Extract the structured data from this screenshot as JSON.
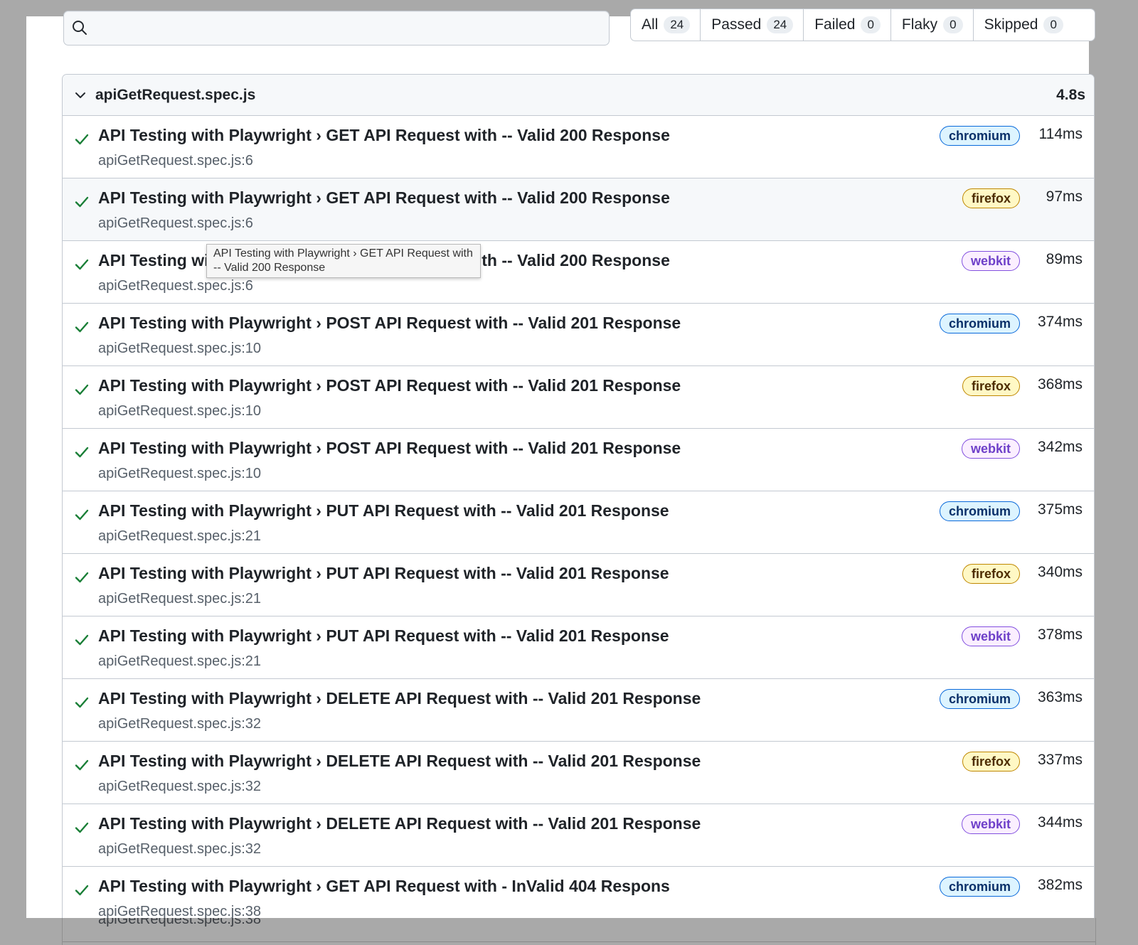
{
  "search": {
    "placeholder": "",
    "value": ""
  },
  "filters": [
    {
      "label": "All",
      "count": "24"
    },
    {
      "label": "Passed",
      "count": "24"
    },
    {
      "label": "Failed",
      "count": "0"
    },
    {
      "label": "Flaky",
      "count": "0"
    },
    {
      "label": "Skipped",
      "count": "0"
    }
  ],
  "suite": {
    "file": "apiGetRequest.spec.js",
    "duration": "4.8s",
    "tests": [
      {
        "title": "API Testing with Playwright › GET API Request with -- Valid 200 Response",
        "location": "apiGetRequest.spec.js:6",
        "browser": "chromium",
        "duration": "114ms"
      },
      {
        "title": "API Testing with Playwright › GET API Request with -- Valid 200 Response",
        "location": "apiGetRequest.spec.js:6",
        "browser": "firefox",
        "duration": "97ms"
      },
      {
        "title": "API Testing with Playwright › GET API Request with -- Valid 200 Response",
        "location": "apiGetRequest.spec.js:6",
        "browser": "webkit",
        "duration": "89ms"
      },
      {
        "title": "API Testing with Playwright › POST API Request with -- Valid 201 Response",
        "location": "apiGetRequest.spec.js:10",
        "browser": "chromium",
        "duration": "374ms"
      },
      {
        "title": "API Testing with Playwright › POST API Request with -- Valid 201 Response",
        "location": "apiGetRequest.spec.js:10",
        "browser": "firefox",
        "duration": "368ms"
      },
      {
        "title": "API Testing with Playwright › POST API Request with -- Valid 201 Response",
        "location": "apiGetRequest.spec.js:10",
        "browser": "webkit",
        "duration": "342ms"
      },
      {
        "title": "API Testing with Playwright › PUT API Request with -- Valid 201 Response",
        "location": "apiGetRequest.spec.js:21",
        "browser": "chromium",
        "duration": "375ms"
      },
      {
        "title": "API Testing with Playwright › PUT API Request with -- Valid 201 Response",
        "location": "apiGetRequest.spec.js:21",
        "browser": "firefox",
        "duration": "340ms"
      },
      {
        "title": "API Testing with Playwright › PUT API Request with -- Valid 201 Response",
        "location": "apiGetRequest.spec.js:21",
        "browser": "webkit",
        "duration": "378ms"
      },
      {
        "title": "API Testing with Playwright › DELETE API Request with -- Valid 201 Response",
        "location": "apiGetRequest.spec.js:32",
        "browser": "chromium",
        "duration": "363ms"
      },
      {
        "title": "API Testing with Playwright › DELETE API Request with -- Valid 201 Response",
        "location": "apiGetRequest.spec.js:32",
        "browser": "firefox",
        "duration": "337ms"
      },
      {
        "title": "API Testing with Playwright › DELETE API Request with -- Valid 201 Response",
        "location": "apiGetRequest.spec.js:32",
        "browser": "webkit",
        "duration": "344ms"
      },
      {
        "title": "API Testing with Playwright › GET API Request with - InValid 404 Respons",
        "location": "apiGetRequest.spec.js:38",
        "browser": "chromium",
        "duration": "382ms"
      }
    ]
  },
  "tooltip": {
    "text": "API Testing with Playwright › GET API Request with -- Valid 200 Response"
  },
  "icons": {
    "search": "search-icon",
    "chevron": "chevron-down-icon",
    "check": "check-icon"
  },
  "colors": {
    "check": "#1a7f37",
    "chromium": "#0969da",
    "firefox": "#bf8700",
    "webkit": "#8250df"
  }
}
